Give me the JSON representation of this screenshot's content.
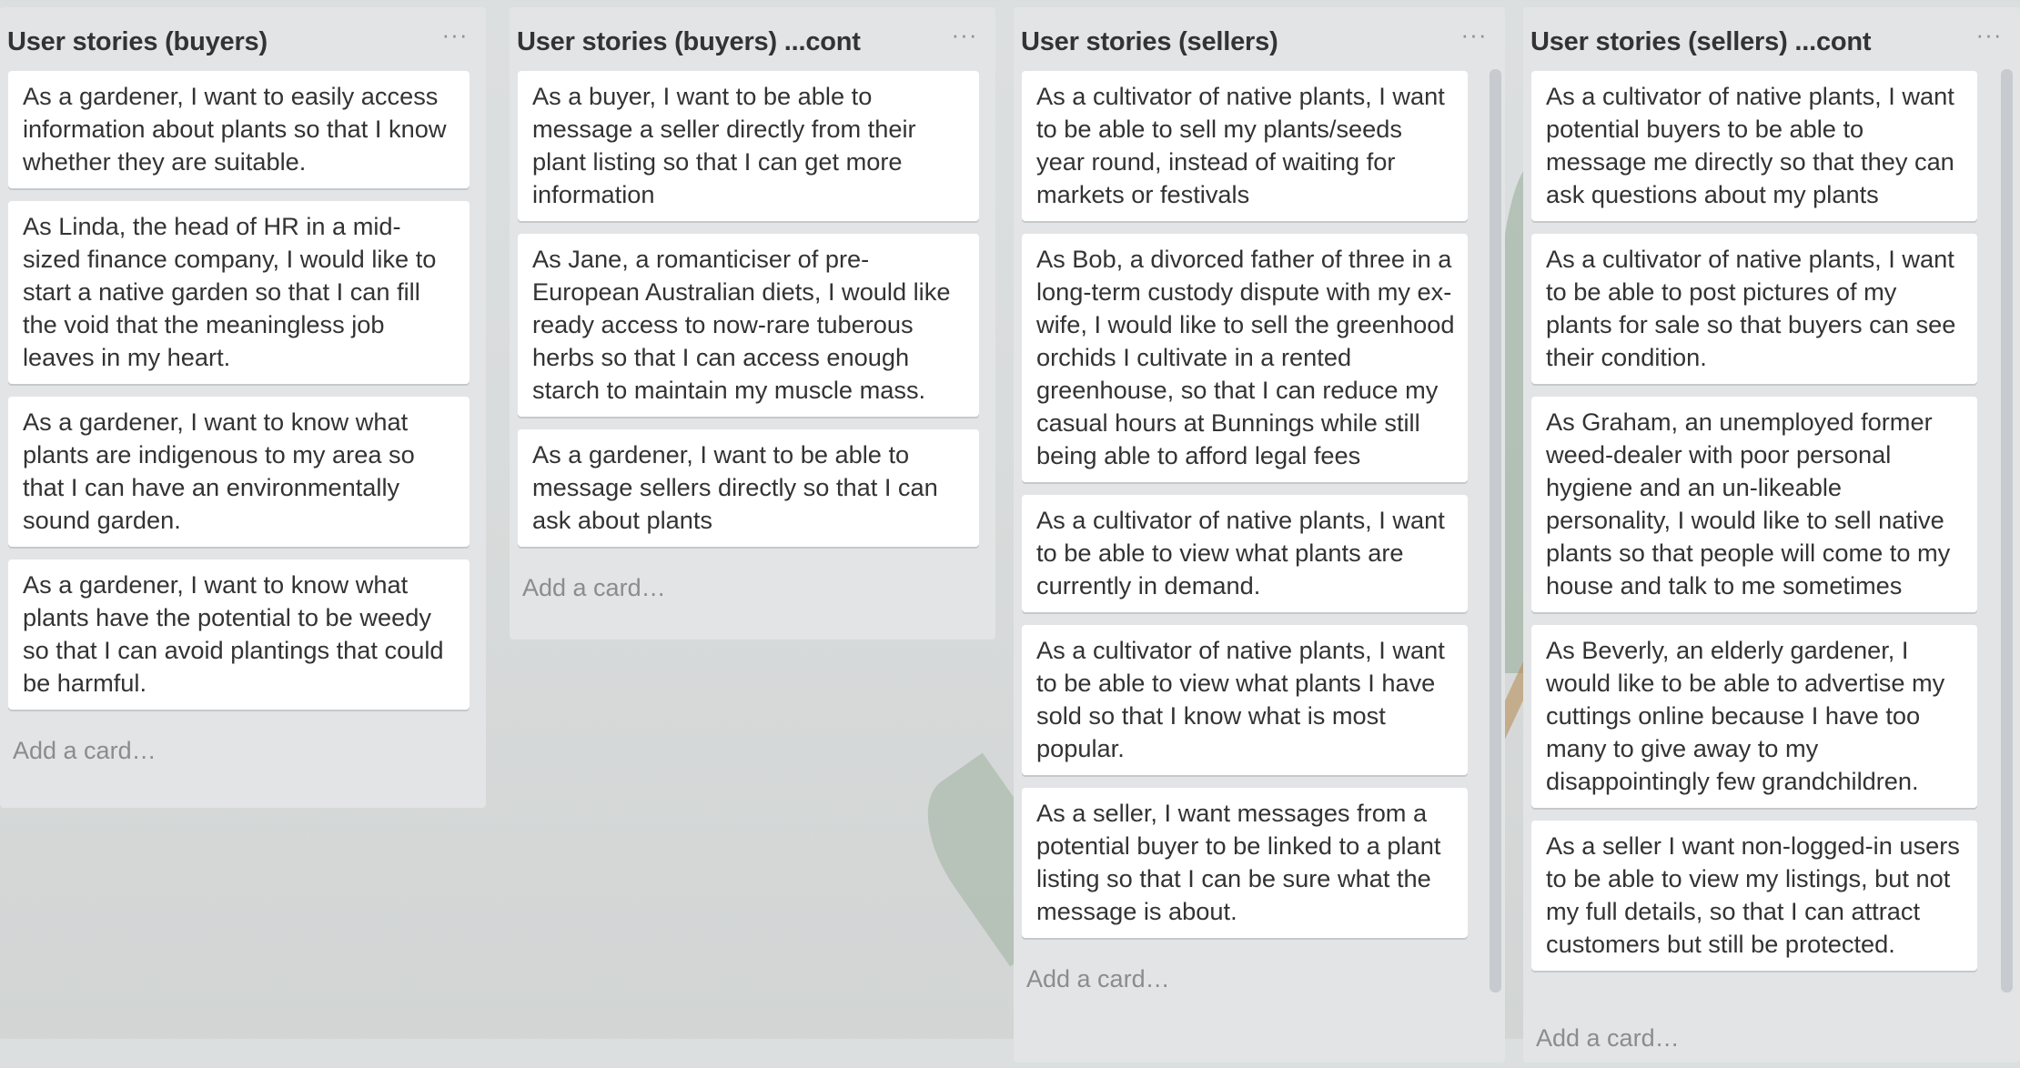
{
  "lists": [
    {
      "title": "User stories (buyers)",
      "menu": "···",
      "cards": [
        "As a gardener, I want to easily access information about plants so that I know whether they are suitable.",
        "As Linda, the head of HR in a mid-sized finance company, I would like to start a native garden so that I can fill the void that the meaningless job leaves in my heart.",
        "As a gardener, I want to know what plants are indigenous to my area so that I can have an environmentally sound garden.",
        "As a gardener, I want to know what plants have the potential to be weedy so that I can avoid plantings that could be harmful."
      ],
      "add_card": "Add a card…"
    },
    {
      "title": "User stories (buyers) ...cont",
      "menu": "···",
      "cards": [
        "As a buyer, I want to be able to message a seller directly from their plant listing so that I can get more information",
        "As Jane, a romanticiser of pre-European Australian diets, I would like ready access to now-rare tuberous herbs so that I can access enough starch to maintain my muscle mass.",
        "As a gardener, I want to be able to message sellers directly so that I can ask about plants"
      ],
      "add_card": "Add a card…"
    },
    {
      "title": "User stories (sellers)",
      "menu": "···",
      "cards": [
        "As a cultivator of native plants, I want to be able to sell my plants/seeds year round, instead of waiting for markets or festivals",
        "As Bob, a divorced father of three in a long-term custody dispute with my ex-wife, I would like to sell the greenhood orchids I cultivate in a rented greenhouse, so that I can reduce my casual hours at Bunnings while still being able to afford legal fees",
        "As a cultivator of native plants, I want to be able to view what plants are currently in demand.",
        "As a cultivator of native plants, I want to be able to view what plants I have sold so that I know what is most popular.",
        "As a seller, I want messages from a potential buyer to be linked to a plant listing so that I can be sure what the message is about."
      ],
      "add_card": "Add a card…"
    },
    {
      "title": "User stories (sellers) ...cont",
      "menu": "···",
      "cards": [
        "As a cultivator of native plants, I want potential buyers to be able to message me directly so that they can ask questions about my plants",
        "As a cultivator of native plants, I want to be able to post pictures of my plants for sale so that buyers can see their condition.",
        "As Graham, an unemployed former weed-dealer with poor personal hygiene and an un-likeable personality, I would like to sell native plants so that people will come to my house and talk to me sometimes",
        "As Beverly, an elderly gardener, I would like to be able to advertise my cuttings online because I have too many to give away to my disappointingly few grandchildren.",
        "As a seller I want non-logged-in users to be able to view my listings, but not my full details, so that I can attract customers but still be protected."
      ],
      "add_card": "Add a card…"
    }
  ],
  "colors": {
    "list_bg": "#e2e4e6",
    "card_bg": "#ffffff",
    "text": "#333333",
    "muted": "#8c8c8c"
  }
}
